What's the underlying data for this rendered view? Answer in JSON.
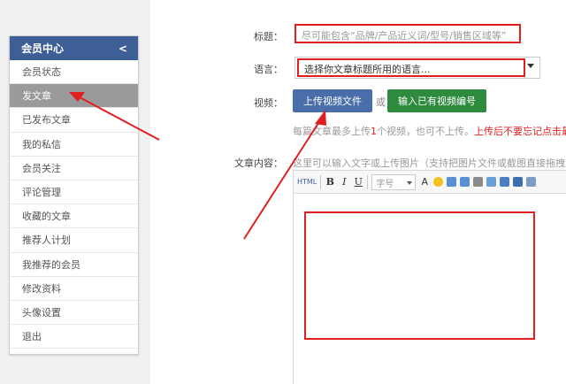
{
  "sidebar": {
    "title": "会员中心",
    "collapse_glyph": "<",
    "items": [
      {
        "label": "会员状态"
      },
      {
        "label": "发文章"
      },
      {
        "label": "已发布文章"
      },
      {
        "label": "我的私信"
      },
      {
        "label": "会员关注"
      },
      {
        "label": "评论管理"
      },
      {
        "label": "收藏的文章"
      },
      {
        "label": "推荐人计划"
      },
      {
        "label": "我推荐的会员"
      },
      {
        "label": "修改资料"
      },
      {
        "label": "头像设置"
      },
      {
        "label": "退出"
      }
    ],
    "active_index": 1
  },
  "form": {
    "title_label": "标题：",
    "title_placeholder": "尽可能包含“品牌/产品近义词/型号/销售区域等”",
    "language_label": "语言：",
    "language_value": "选择你文章标题所用的语言...",
    "video_label": "视频：",
    "upload_button": "上传视频文件",
    "or_text": "或",
    "code_button": "输入已有视频编号",
    "note_prefix": "每篇文章最多上传",
    "note_count": "1",
    "note_suffix": "个视频，也可不上传。",
    "note_warning": "上传后不要忘记点击最下面",
    "content_label": "文章内容：",
    "content_hint": "这里可以输入文字或上传图片（支持把图片文件或截图直接拖拽到这里"
  },
  "toolbar": {
    "source": "HTML",
    "bold": "B",
    "italic": "I",
    "underline": "U",
    "font_size": "字号",
    "font_color": "A"
  },
  "colors": {
    "header_blue": "#3e5f95",
    "upload_blue": "#4a6ea9",
    "code_green": "#2e8b3e",
    "annotation_red": "#e02020",
    "active_gray": "#9a9a9a"
  }
}
